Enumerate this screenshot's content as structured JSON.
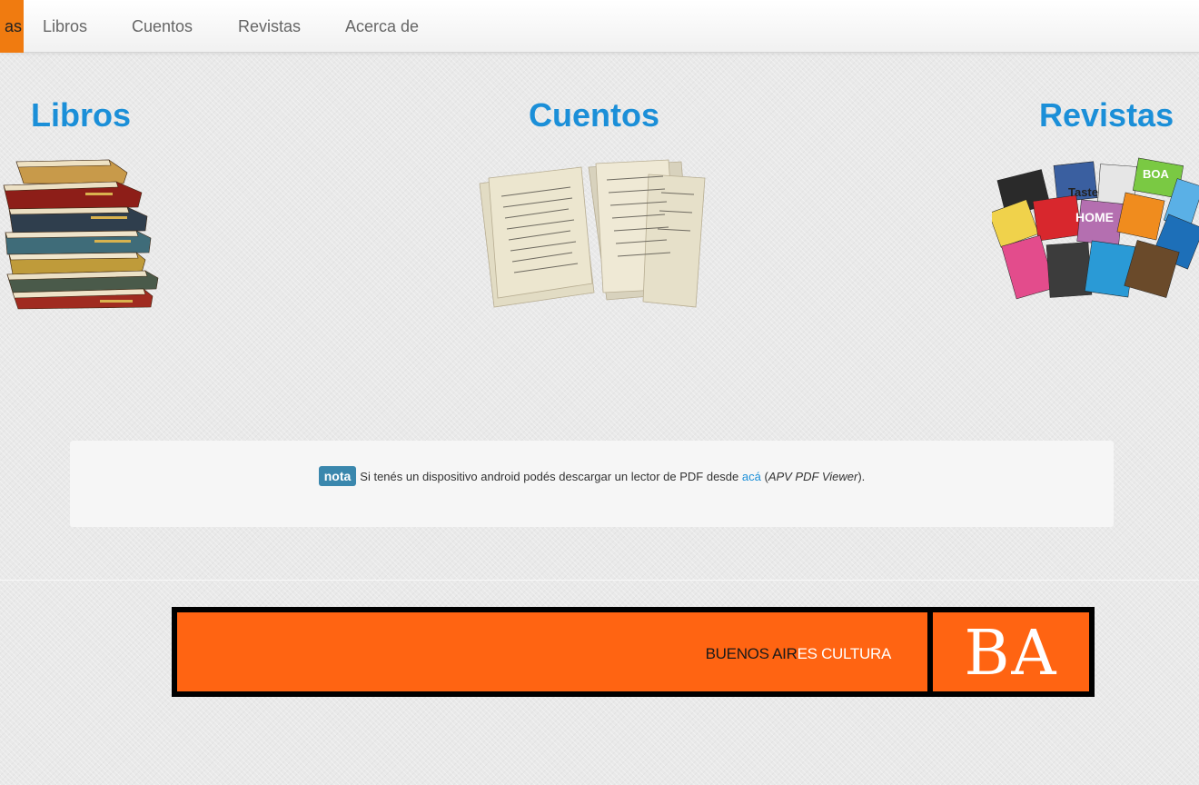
{
  "nav": {
    "brand": "as",
    "links": [
      "Libros",
      "Cuentos",
      "Revistas",
      "Acerca de"
    ]
  },
  "sections": [
    {
      "title": "Libros",
      "image": "book-stack-icon"
    },
    {
      "title": "Cuentos",
      "image": "manuscript-pages-icon"
    },
    {
      "title": "Revistas",
      "image": "magazine-pile-icon"
    }
  ],
  "note": {
    "badge": "nota",
    "text": "Si tenés un dispositivo android podés descargar un lector de PDF desde",
    "link": "acá",
    "paren_open": " (",
    "app_name": "APV PDF Viewer",
    "paren_close": ")."
  },
  "banner": {
    "text_dark_1": "BUENOS AIR",
    "text_light": "ES CULTURA",
    "logo": "BA"
  },
  "colors": {
    "accent_blue": "#1b8fd8",
    "brand_orange": "#f07b10",
    "banner_orange": "#ff6412",
    "badge_blue": "#3a87ad"
  }
}
